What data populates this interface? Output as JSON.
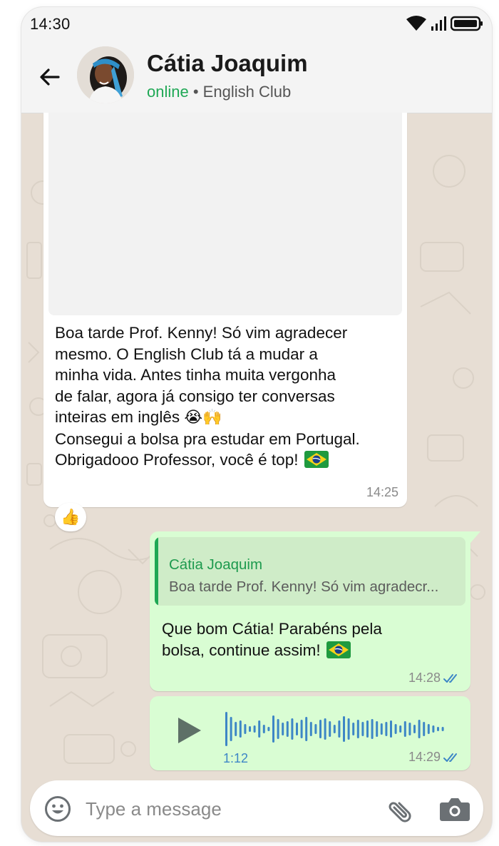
{
  "status_bar": {
    "time": "14:30",
    "icons": [
      "wifi-icon",
      "signal-icon",
      "battery-icon"
    ]
  },
  "header": {
    "contact_name": "Cátia Joaquim",
    "status": "online",
    "separator": "•",
    "group": "English Club",
    "icons": [
      "back-arrow-icon",
      "avatar"
    ]
  },
  "messages": [
    {
      "direction": "incoming",
      "has_photo": true,
      "lines": [
        "Boa tarde Prof. Kenny! Só vim agradecer",
        "mesmo. O English Club tá a mudar a",
        "minha vida. Antes tinha muita vergonha",
        "de falar, agora já consigo ter conversas",
        "inteiras em inglês",
        "Consegui a bolsa pra estudar em Portugal.",
        "Obrigadooo Professor, você é top!"
      ],
      "emoji_after_line_5": "😭🙌",
      "flag": "brazil-flag-icon",
      "time": "14:25",
      "reaction": "👍"
    },
    {
      "direction": "outgoing",
      "reply_to": {
        "name": "Cátia Joaquim",
        "text": "Boa tarde Prof. Kenny! Só vim agradecr..."
      },
      "lines": [
        "Que bom Cátia! Parabéns pela",
        "bolsa, continue assim!"
      ],
      "flag": "brazil-flag-icon",
      "time": "14:28",
      "read_status": "double-check-icon"
    },
    {
      "direction": "outgoing",
      "type": "voice",
      "duration": "1:12",
      "time": "14:29",
      "read_status": "double-check-icon"
    }
  ],
  "composer": {
    "placeholder": "Type a message",
    "icons": [
      "emoji-icon",
      "attach-icon",
      "camera-icon"
    ]
  },
  "colors": {
    "accent_green": "#1fa855",
    "outgoing_bubble": "#d9fdd3",
    "incoming_bubble": "#ffffff",
    "chat_background": "#e7ded4",
    "read_ticks": "#3d86c6"
  }
}
